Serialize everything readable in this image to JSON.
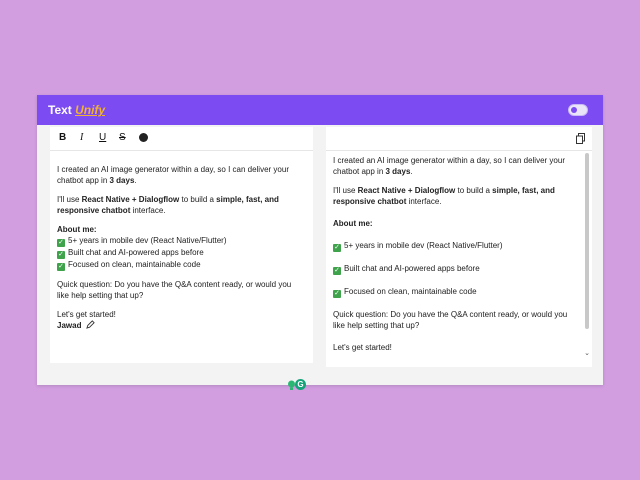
{
  "app": {
    "title_main": "Text ",
    "title_accent": "Unify"
  },
  "toolbar": {
    "bold": "B",
    "italic": "I",
    "underline": "U",
    "strike": "S"
  },
  "message": {
    "intro_1": "I created an AI image generator within a day, so I can deliver your chatbot app in ",
    "intro_bold": "3 days",
    "intro_end": ".",
    "stack_1": "I'll use ",
    "stack_bold_1": "React Native + Dialogflow",
    "stack_2": " to build a ",
    "stack_bold_2": "simple, fast, and responsive chatbot",
    "stack_3": " interface.",
    "about_heading": "About me:",
    "about_items": [
      "5+ years in mobile dev (React Native/Flutter)",
      "Built chat and AI-powered apps before",
      "Focused on clean, maintainable code"
    ],
    "question": "Quick question: Do you have the Q&A content ready, or would you like help setting that up?",
    "closing": "Let's get started!",
    "signature": "Jawad"
  },
  "colors": {
    "header": "#7c4bf1",
    "accent": "#f2b233",
    "background": "#d29ee0",
    "check": "#3ea34a"
  },
  "icons": [
    "bold-icon",
    "italic-icon",
    "underline-icon",
    "strikethrough-icon",
    "emoji-icon",
    "copy-icon",
    "lightbulb-icon",
    "grammar-icon",
    "check-icon",
    "pencil-icon",
    "theme-toggle"
  ]
}
